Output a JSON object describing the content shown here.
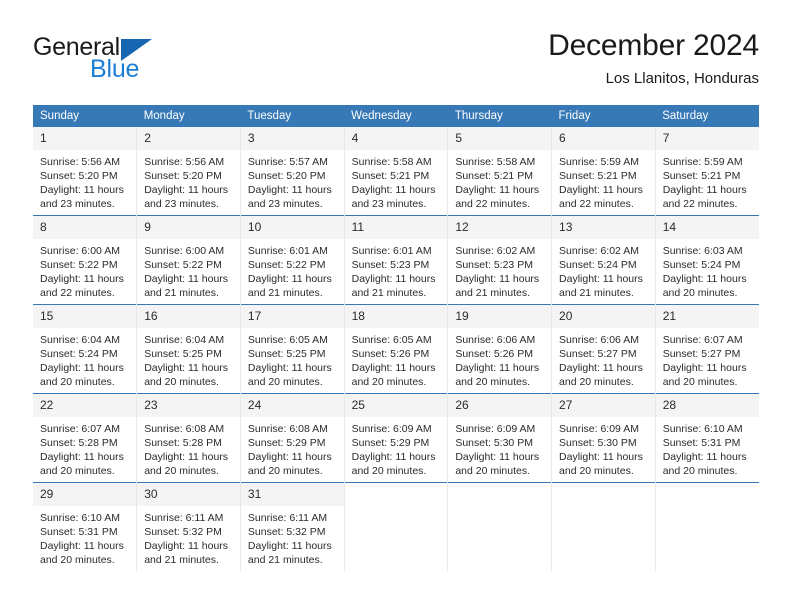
{
  "brand": {
    "name_part1": "General",
    "name_part2": "Blue",
    "accent_color": "#1a7fd4",
    "triangle_color": "#1565b0"
  },
  "header": {
    "title": "December 2024",
    "subtitle": "Los Llanitos, Honduras"
  },
  "calendar": {
    "header_color": "#3679b6",
    "weekday_headers": [
      "Sunday",
      "Monday",
      "Tuesday",
      "Wednesday",
      "Thursday",
      "Friday",
      "Saturday"
    ],
    "labels": {
      "sunrise": "Sunrise:",
      "sunset": "Sunset:",
      "daylight": "Daylight:"
    },
    "weeks": [
      [
        {
          "day": "1",
          "sunrise": "Sunrise: 5:56 AM",
          "sunset": "Sunset: 5:20 PM",
          "daylight": "Daylight: 11 hours and 23 minutes."
        },
        {
          "day": "2",
          "sunrise": "Sunrise: 5:56 AM",
          "sunset": "Sunset: 5:20 PM",
          "daylight": "Daylight: 11 hours and 23 minutes."
        },
        {
          "day": "3",
          "sunrise": "Sunrise: 5:57 AM",
          "sunset": "Sunset: 5:20 PM",
          "daylight": "Daylight: 11 hours and 23 minutes."
        },
        {
          "day": "4",
          "sunrise": "Sunrise: 5:58 AM",
          "sunset": "Sunset: 5:21 PM",
          "daylight": "Daylight: 11 hours and 23 minutes."
        },
        {
          "day": "5",
          "sunrise": "Sunrise: 5:58 AM",
          "sunset": "Sunset: 5:21 PM",
          "daylight": "Daylight: 11 hours and 22 minutes."
        },
        {
          "day": "6",
          "sunrise": "Sunrise: 5:59 AM",
          "sunset": "Sunset: 5:21 PM",
          "daylight": "Daylight: 11 hours and 22 minutes."
        },
        {
          "day": "7",
          "sunrise": "Sunrise: 5:59 AM",
          "sunset": "Sunset: 5:21 PM",
          "daylight": "Daylight: 11 hours and 22 minutes."
        }
      ],
      [
        {
          "day": "8",
          "sunrise": "Sunrise: 6:00 AM",
          "sunset": "Sunset: 5:22 PM",
          "daylight": "Daylight: 11 hours and 22 minutes."
        },
        {
          "day": "9",
          "sunrise": "Sunrise: 6:00 AM",
          "sunset": "Sunset: 5:22 PM",
          "daylight": "Daylight: 11 hours and 21 minutes."
        },
        {
          "day": "10",
          "sunrise": "Sunrise: 6:01 AM",
          "sunset": "Sunset: 5:22 PM",
          "daylight": "Daylight: 11 hours and 21 minutes."
        },
        {
          "day": "11",
          "sunrise": "Sunrise: 6:01 AM",
          "sunset": "Sunset: 5:23 PM",
          "daylight": "Daylight: 11 hours and 21 minutes."
        },
        {
          "day": "12",
          "sunrise": "Sunrise: 6:02 AM",
          "sunset": "Sunset: 5:23 PM",
          "daylight": "Daylight: 11 hours and 21 minutes."
        },
        {
          "day": "13",
          "sunrise": "Sunrise: 6:02 AM",
          "sunset": "Sunset: 5:24 PM",
          "daylight": "Daylight: 11 hours and 21 minutes."
        },
        {
          "day": "14",
          "sunrise": "Sunrise: 6:03 AM",
          "sunset": "Sunset: 5:24 PM",
          "daylight": "Daylight: 11 hours and 20 minutes."
        }
      ],
      [
        {
          "day": "15",
          "sunrise": "Sunrise: 6:04 AM",
          "sunset": "Sunset: 5:24 PM",
          "daylight": "Daylight: 11 hours and 20 minutes."
        },
        {
          "day": "16",
          "sunrise": "Sunrise: 6:04 AM",
          "sunset": "Sunset: 5:25 PM",
          "daylight": "Daylight: 11 hours and 20 minutes."
        },
        {
          "day": "17",
          "sunrise": "Sunrise: 6:05 AM",
          "sunset": "Sunset: 5:25 PM",
          "daylight": "Daylight: 11 hours and 20 minutes."
        },
        {
          "day": "18",
          "sunrise": "Sunrise: 6:05 AM",
          "sunset": "Sunset: 5:26 PM",
          "daylight": "Daylight: 11 hours and 20 minutes."
        },
        {
          "day": "19",
          "sunrise": "Sunrise: 6:06 AM",
          "sunset": "Sunset: 5:26 PM",
          "daylight": "Daylight: 11 hours and 20 minutes."
        },
        {
          "day": "20",
          "sunrise": "Sunrise: 6:06 AM",
          "sunset": "Sunset: 5:27 PM",
          "daylight": "Daylight: 11 hours and 20 minutes."
        },
        {
          "day": "21",
          "sunrise": "Sunrise: 6:07 AM",
          "sunset": "Sunset: 5:27 PM",
          "daylight": "Daylight: 11 hours and 20 minutes."
        }
      ],
      [
        {
          "day": "22",
          "sunrise": "Sunrise: 6:07 AM",
          "sunset": "Sunset: 5:28 PM",
          "daylight": "Daylight: 11 hours and 20 minutes."
        },
        {
          "day": "23",
          "sunrise": "Sunrise: 6:08 AM",
          "sunset": "Sunset: 5:28 PM",
          "daylight": "Daylight: 11 hours and 20 minutes."
        },
        {
          "day": "24",
          "sunrise": "Sunrise: 6:08 AM",
          "sunset": "Sunset: 5:29 PM",
          "daylight": "Daylight: 11 hours and 20 minutes."
        },
        {
          "day": "25",
          "sunrise": "Sunrise: 6:09 AM",
          "sunset": "Sunset: 5:29 PM",
          "daylight": "Daylight: 11 hours and 20 minutes."
        },
        {
          "day": "26",
          "sunrise": "Sunrise: 6:09 AM",
          "sunset": "Sunset: 5:30 PM",
          "daylight": "Daylight: 11 hours and 20 minutes."
        },
        {
          "day": "27",
          "sunrise": "Sunrise: 6:09 AM",
          "sunset": "Sunset: 5:30 PM",
          "daylight": "Daylight: 11 hours and 20 minutes."
        },
        {
          "day": "28",
          "sunrise": "Sunrise: 6:10 AM",
          "sunset": "Sunset: 5:31 PM",
          "daylight": "Daylight: 11 hours and 20 minutes."
        }
      ],
      [
        {
          "day": "29",
          "sunrise": "Sunrise: 6:10 AM",
          "sunset": "Sunset: 5:31 PM",
          "daylight": "Daylight: 11 hours and 20 minutes."
        },
        {
          "day": "30",
          "sunrise": "Sunrise: 6:11 AM",
          "sunset": "Sunset: 5:32 PM",
          "daylight": "Daylight: 11 hours and 21 minutes."
        },
        {
          "day": "31",
          "sunrise": "Sunrise: 6:11 AM",
          "sunset": "Sunset: 5:32 PM",
          "daylight": "Daylight: 11 hours and 21 minutes."
        },
        {
          "day": "",
          "sunrise": "",
          "sunset": "",
          "daylight": ""
        },
        {
          "day": "",
          "sunrise": "",
          "sunset": "",
          "daylight": ""
        },
        {
          "day": "",
          "sunrise": "",
          "sunset": "",
          "daylight": ""
        },
        {
          "day": "",
          "sunrise": "",
          "sunset": "",
          "daylight": ""
        }
      ]
    ]
  }
}
